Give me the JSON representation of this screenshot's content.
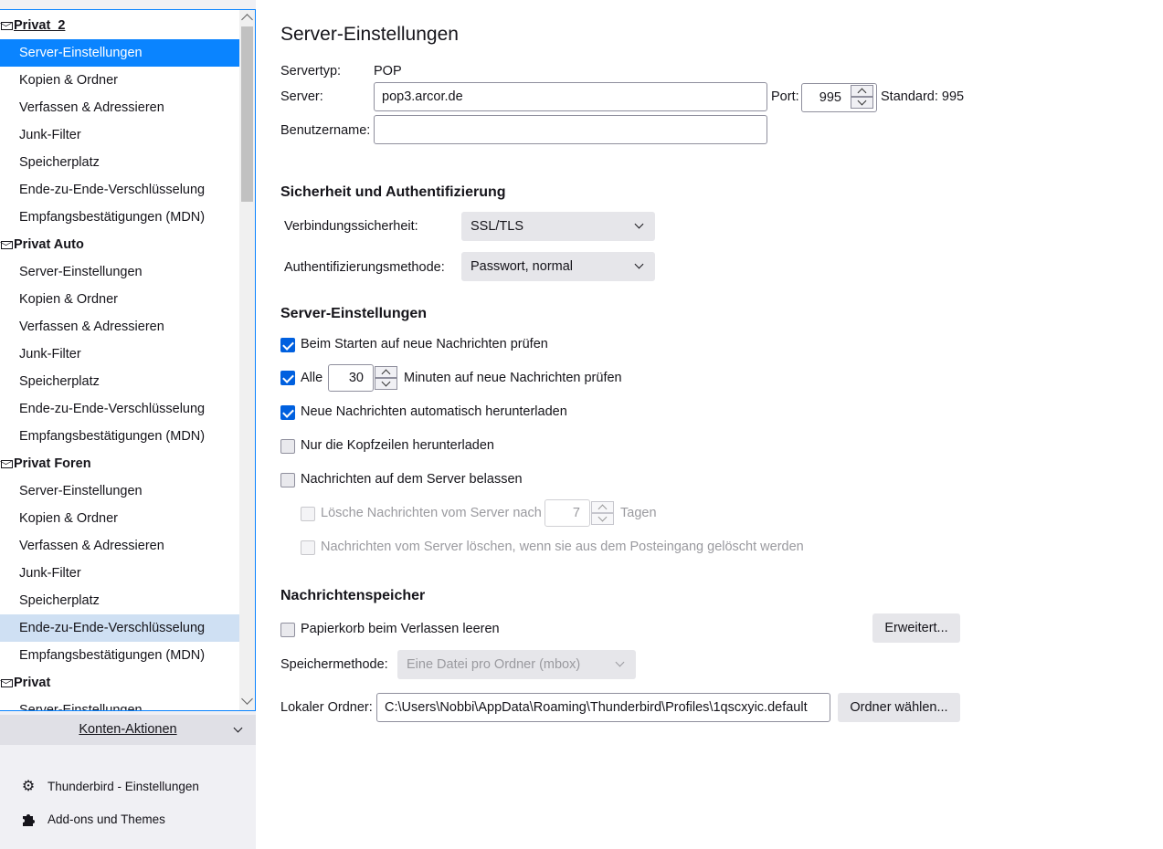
{
  "sidebar": {
    "accounts": [
      {
        "name": "Privat_2",
        "items": [
          "Server-Einstellungen",
          "Kopien & Ordner",
          "Verfassen & Adressieren",
          "Junk-Filter",
          "Speicherplatz",
          "Ende-zu-Ende-Verschlüsselung",
          "Empfangsbestätigungen (MDN)"
        ]
      },
      {
        "name": "Privat Auto",
        "items": [
          "Server-Einstellungen",
          "Kopien & Ordner",
          "Verfassen & Adressieren",
          "Junk-Filter",
          "Speicherplatz",
          "Ende-zu-Ende-Verschlüsselung",
          "Empfangsbestätigungen (MDN)"
        ]
      },
      {
        "name": "Privat Foren",
        "items": [
          "Server-Einstellungen",
          "Kopien & Ordner",
          "Verfassen & Adressieren",
          "Junk-Filter",
          "Speicherplatz",
          "Ende-zu-Ende-Verschlüsselung",
          "Empfangsbestätigungen (MDN)"
        ]
      },
      {
        "name": "Privat",
        "items": [
          "Server-Einstellungen"
        ]
      }
    ],
    "account_actions": "Konten-Aktionen",
    "settings_link": "Thunderbird - Einstellungen",
    "addons_link": "Add-ons und Themes"
  },
  "main": {
    "title": "Server-Einstellungen",
    "server_type_label": "Servertyp:",
    "server_type_value": "POP",
    "server_label": "Server:",
    "server_value": "pop3.arcor.de",
    "port_label": "Port:",
    "port_value": "995",
    "port_default": "Standard: 995",
    "username_label": "Benutzername:",
    "username_value": "",
    "security_heading": "Sicherheit und Authentifizierung",
    "conn_security_label": "Verbindungssicherheit:",
    "conn_security_value": "SSL/TLS",
    "auth_method_label": "Authentifizierungsmethode:",
    "auth_method_value": "Passwort, normal",
    "server_settings_heading": "Server-Einstellungen",
    "check_on_start": "Beim Starten auf neue Nachrichten prüfen",
    "check_every_prefix": "Alle",
    "check_every_value": "30",
    "check_every_suffix": "Minuten auf neue Nachrichten prüfen",
    "auto_download": "Neue Nachrichten automatisch herunterladen",
    "headers_only": "Nur die Kopfzeilen herunterladen",
    "leave_on_server": "Nachrichten auf dem Server belassen",
    "delete_after_prefix": "Lösche Nachrichten vom Server nach",
    "delete_after_value": "7",
    "delete_after_suffix": "Tagen",
    "delete_when_deleted": "Nachrichten vom Server löschen, wenn sie aus dem Posteingang gelöscht werden",
    "storage_heading": "Nachrichtenspeicher",
    "empty_trash": "Papierkorb beim Verlassen leeren",
    "advanced_button": "Erweitert...",
    "storage_method_label": "Speichermethode:",
    "storage_method_value": "Eine Datei pro Ordner (mbox)",
    "local_folder_label": "Lokaler Ordner:",
    "local_folder_value": "C:\\Users\\Nobbi\\AppData\\Roaming\\Thunderbird\\Profiles\\1qscxyic.default",
    "choose_folder_button": "Ordner wählen..."
  }
}
